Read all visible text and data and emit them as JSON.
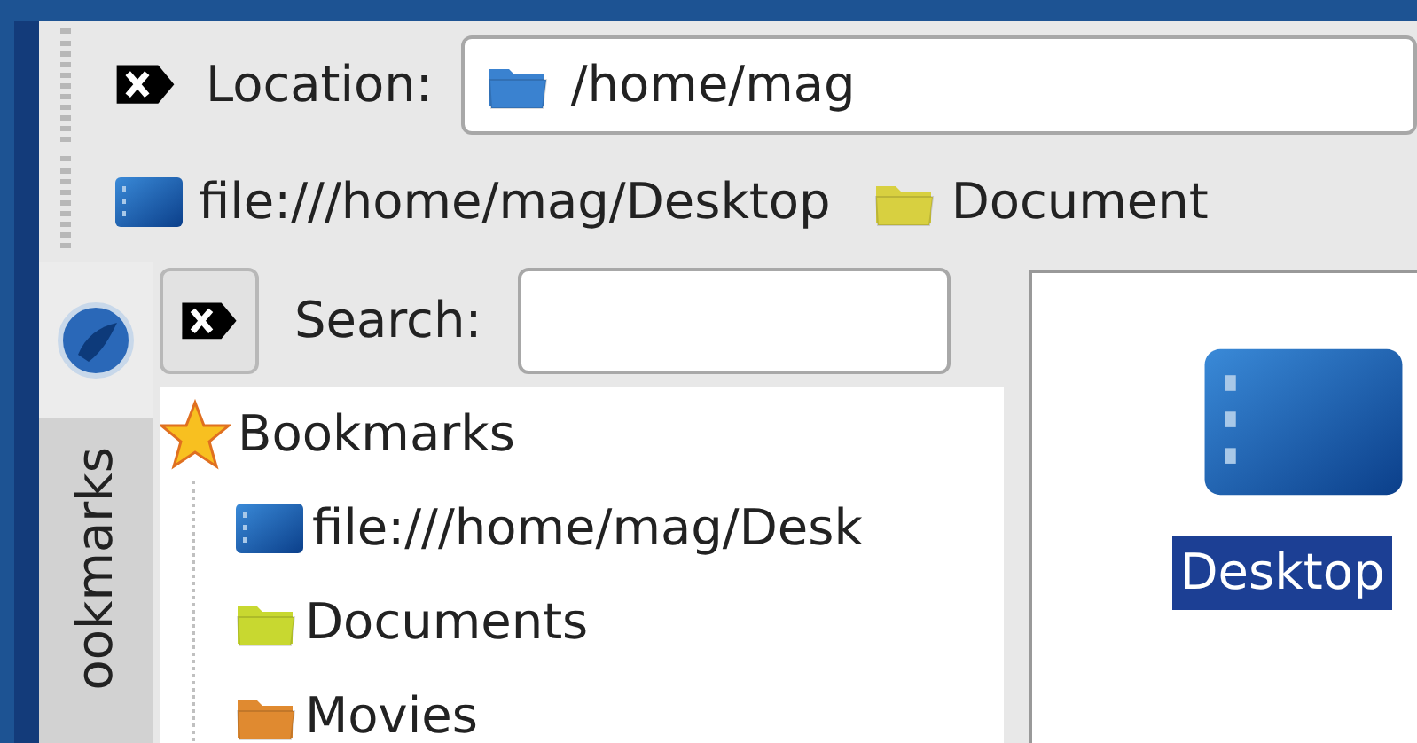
{
  "location_bar": {
    "label": "Location:",
    "value": "/home/mag"
  },
  "bookmark_toolbar": [
    {
      "label": "file:///home/mag/Desktop",
      "kind": "desktop"
    },
    {
      "label": "Document",
      "kind": "folder",
      "color": "#d8d040"
    }
  ],
  "side_tabs": [
    {
      "kind": "globe",
      "selected": true
    },
    {
      "kind": "text",
      "label": "ookmarks",
      "selected": false
    }
  ],
  "sidebar": {
    "search_label": "Search:",
    "tree": {
      "label": "Bookmarks",
      "children": [
        {
          "label": "file:///home/mag/Desk",
          "kind": "desktop"
        },
        {
          "label": "Documents",
          "kind": "folder",
          "color": "#c8d830"
        },
        {
          "label": "Movies",
          "kind": "folder",
          "color": "#e08a30"
        }
      ]
    }
  },
  "file_view": {
    "items": [
      {
        "label": "Desktop",
        "kind": "desktop",
        "selected": true
      }
    ]
  }
}
